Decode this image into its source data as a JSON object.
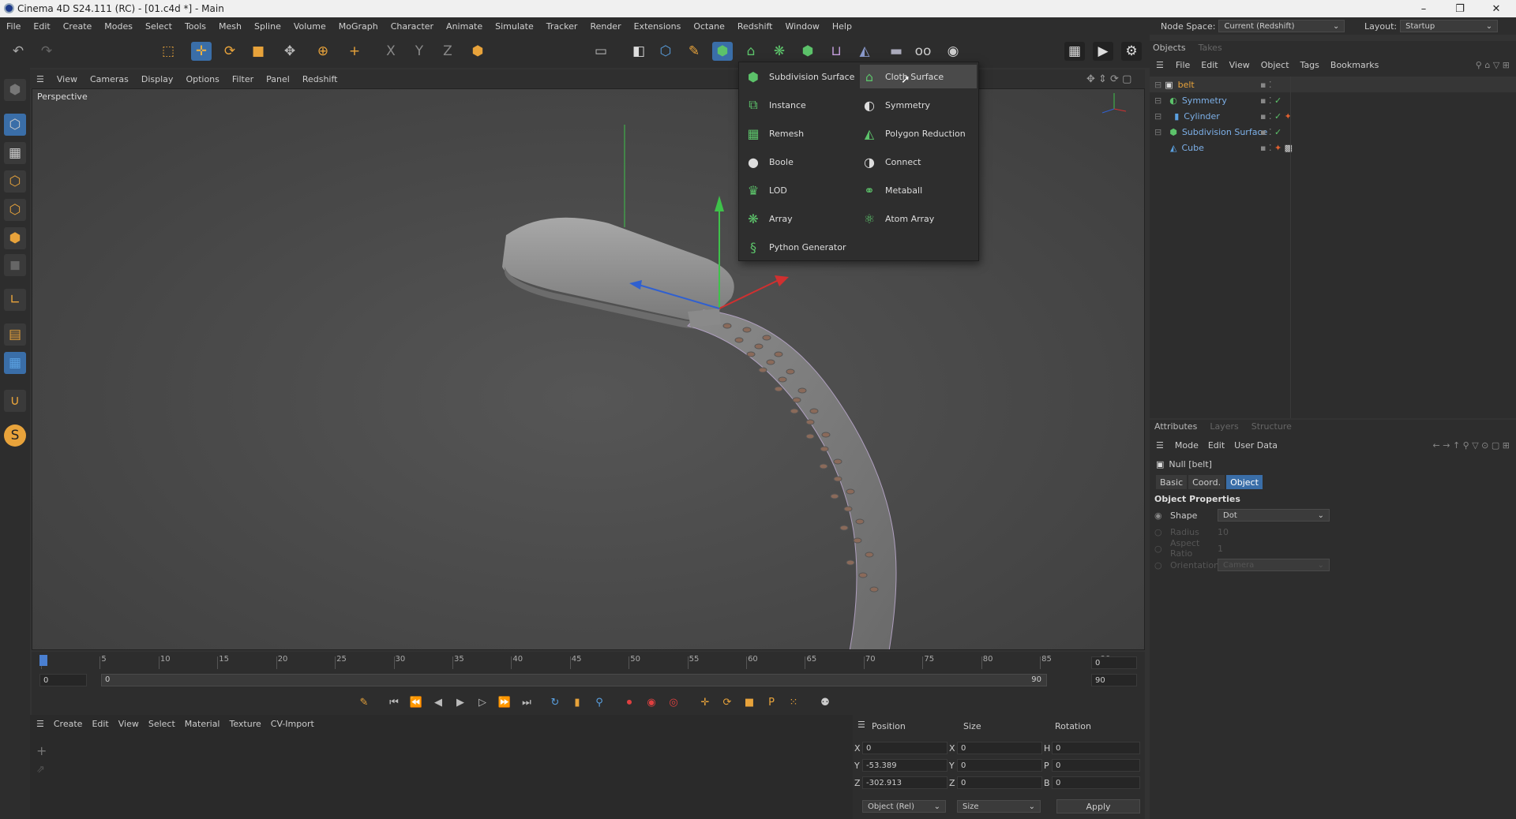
{
  "window": {
    "title": "Cinema 4D S24.111 (RC) - [01.c4d *] - Main"
  },
  "menubar": {
    "items": [
      "File",
      "Edit",
      "Create",
      "Modes",
      "Select",
      "Tools",
      "Mesh",
      "Spline",
      "Volume",
      "MoGraph",
      "Character",
      "Animate",
      "Simulate",
      "Tracker",
      "Render",
      "Extensions",
      "Octane",
      "Redshift",
      "Window",
      "Help"
    ],
    "node_space_label": "Node Space:",
    "node_space_value": "Current (Redshift)",
    "layout_label": "Layout:",
    "layout_value": "Startup"
  },
  "viewport": {
    "menu": [
      "View",
      "Cameras",
      "Display",
      "Options",
      "Filter",
      "Panel",
      "Redshift"
    ],
    "label": "Perspective"
  },
  "generators_popup": {
    "left": [
      "Subdivision Surface",
      "Instance",
      "Remesh",
      "Boole",
      "LOD",
      "Array",
      "Python Generator"
    ],
    "right": [
      "Cloth Surface",
      "Symmetry",
      "Polygon Reduction",
      "Connect",
      "Metaball",
      "Atom Array"
    ],
    "hovered": "Cloth Surface"
  },
  "timeline": {
    "ticks": [
      "0",
      "5",
      "10",
      "15",
      "20",
      "25",
      "30",
      "35",
      "40",
      "45",
      "50",
      "55",
      "60",
      "65",
      "70",
      "75",
      "80",
      "85",
      "90"
    ],
    "current_frame": "0",
    "start": "0",
    "range_start": "0",
    "range_end": "90",
    "end": "90",
    "end_field": "90"
  },
  "material_manager": {
    "menu": [
      "Create",
      "Edit",
      "View",
      "Select",
      "Material",
      "Texture",
      "CV-Import"
    ]
  },
  "coordinates": {
    "headers": [
      "Position",
      "Size",
      "Rotation"
    ],
    "rows": [
      {
        "axis": "X",
        "pos": "0",
        "size_axis": "X",
        "size": "0",
        "rot_axis": "H",
        "rot": "0"
      },
      {
        "axis": "Y",
        "pos": "-53.389",
        "size_axis": "Y",
        "size": "0",
        "rot_axis": "P",
        "rot": "0"
      },
      {
        "axis": "Z",
        "pos": "-302.913",
        "size_axis": "Z",
        "size": "0",
        "rot_axis": "B",
        "rot": "0"
      }
    ],
    "mode": "Object (Rel)",
    "size_mode": "Size",
    "apply": "Apply"
  },
  "objects_panel": {
    "tabs": [
      "Objects",
      "Takes"
    ],
    "menu": [
      "File",
      "Edit",
      "View",
      "Object",
      "Tags",
      "Bookmarks"
    ],
    "tree": [
      "belt",
      "Symmetry",
      "Cylinder",
      "Subdivision Surface",
      "Cube"
    ]
  },
  "attributes_panel": {
    "tabs": [
      "Attributes",
      "Layers",
      "Structure"
    ],
    "menu": [
      "Mode",
      "Edit",
      "User Data"
    ],
    "object_name": "Null [belt]",
    "subtabs": [
      "Basic",
      "Coord.",
      "Object"
    ],
    "section": "Object Properties",
    "props": [
      {
        "label": "Shape",
        "value": "Dot"
      },
      {
        "label": "Radius",
        "value": "10"
      },
      {
        "label": "Aspect Ratio",
        "value": "1"
      },
      {
        "label": "Orientation",
        "value": "Camera"
      }
    ]
  },
  "colors": {
    "accent": "#3a6ea8",
    "generator_green": "#5cc26a",
    "timeline_marker": "#4a7fd0"
  }
}
